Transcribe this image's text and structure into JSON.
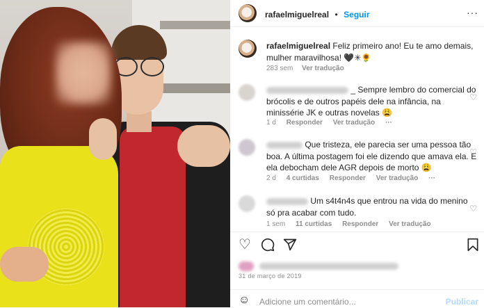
{
  "post": {
    "username": "rafaelmiguelreal",
    "separator": "•",
    "follow_label": "Seguir",
    "more_label": "···",
    "caption": "Feliz primeiro ano! Eu te amo demais, mulher maravilhosa! 🖤✳🌻",
    "caption_age": "283 sem",
    "caption_translate": "Ver tradução"
  },
  "comments": [
    {
      "text": "_ Sempre lembro do comercial do brócolis e de outros papéis dele na infância, na minissérie JK e outras novelas 😩",
      "age": "1 d",
      "reply": "Responder",
      "translate": "Ver tradução",
      "more": "···",
      "avatar_color": "#d8d4d0"
    },
    {
      "text": "Que tristeza, ele parecia ser uma pessoa tão boa. A última postagem foi ele dizendo que amava ela. E ela debocham dele AGR depois de morto 😩",
      "age": "2 d",
      "likes": "4 curtidas",
      "reply": "Responder",
      "translate": "Ver tradução",
      "more": "···",
      "avatar_color": "#cfc7cf"
    },
    {
      "text": "Um s4t4n4s que entrou na vida do menino só pra acabar com tudo.",
      "age": "1 sem",
      "likes": "11 curtidas",
      "reply": "Responder",
      "translate": "Ver tradução",
      "avatar_color": "#d9d9d9"
    }
  ],
  "actions": {
    "like_icon": "heart-icon",
    "comment_icon": "comment-icon",
    "share_icon": "share-icon",
    "save_icon": "bookmark-icon"
  },
  "date": "31 de março de 2019",
  "add_comment": {
    "placeholder": "Adicione um comentário...",
    "publish_label": "Publicar"
  }
}
